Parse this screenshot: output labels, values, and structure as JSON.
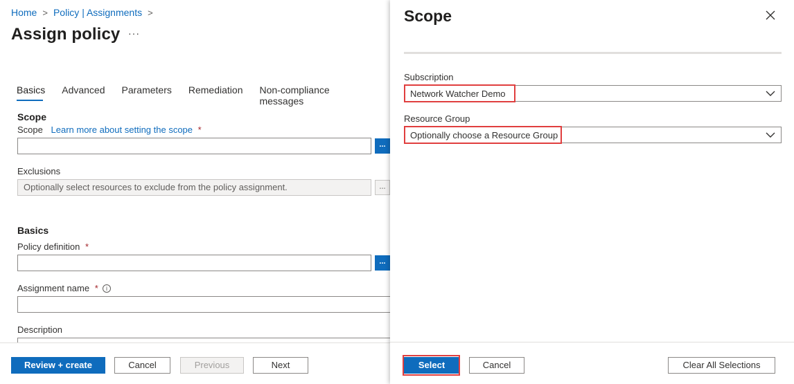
{
  "breadcrumb": {
    "home": "Home",
    "sep1": ">",
    "assignments": "Policy | Assignments",
    "sep2": ">"
  },
  "page": {
    "title": "Assign policy",
    "more": "···"
  },
  "tabs": [
    {
      "label": "Basics",
      "active": true
    },
    {
      "label": "Advanced"
    },
    {
      "label": "Parameters"
    },
    {
      "label": "Remediation"
    },
    {
      "label": "Non-compliance messages"
    }
  ],
  "scope_section": {
    "heading": "Scope",
    "scope_label": "Scope",
    "scope_link": "Learn more about setting the scope",
    "required": "*",
    "scope_value": "",
    "scope_button": "...",
    "exclusions_label": "Exclusions",
    "exclusions_placeholder": "Optionally select resources to exclude from the policy assignment.",
    "exclusions_button": "..."
  },
  "basics_section": {
    "heading": "Basics",
    "policy_definition_label": "Policy definition",
    "policy_definition_button": "...",
    "assignment_name_label": "Assignment name",
    "info_icon": "i",
    "description_label": "Description",
    "required": "*"
  },
  "footer_left": {
    "review_create": "Review + create",
    "cancel": "Cancel",
    "previous": "Previous",
    "next": "Next"
  },
  "scope_panel": {
    "title": "Scope",
    "subscription_label": "Subscription",
    "subscription_value": "Network Watcher Demo",
    "resource_group_label": "Resource Group",
    "resource_group_value": "Optionally choose a Resource Group",
    "select": "Select",
    "cancel": "Cancel",
    "clear_all": "Clear All Selections"
  },
  "colors": {
    "accent": "#0f6cbd",
    "highlight": "#e03e3e",
    "required": "#a4262c"
  },
  "icons": [
    "chevron-right-icon",
    "close-icon",
    "chevron-down-icon",
    "info-icon",
    "ellipsis-icon"
  ]
}
